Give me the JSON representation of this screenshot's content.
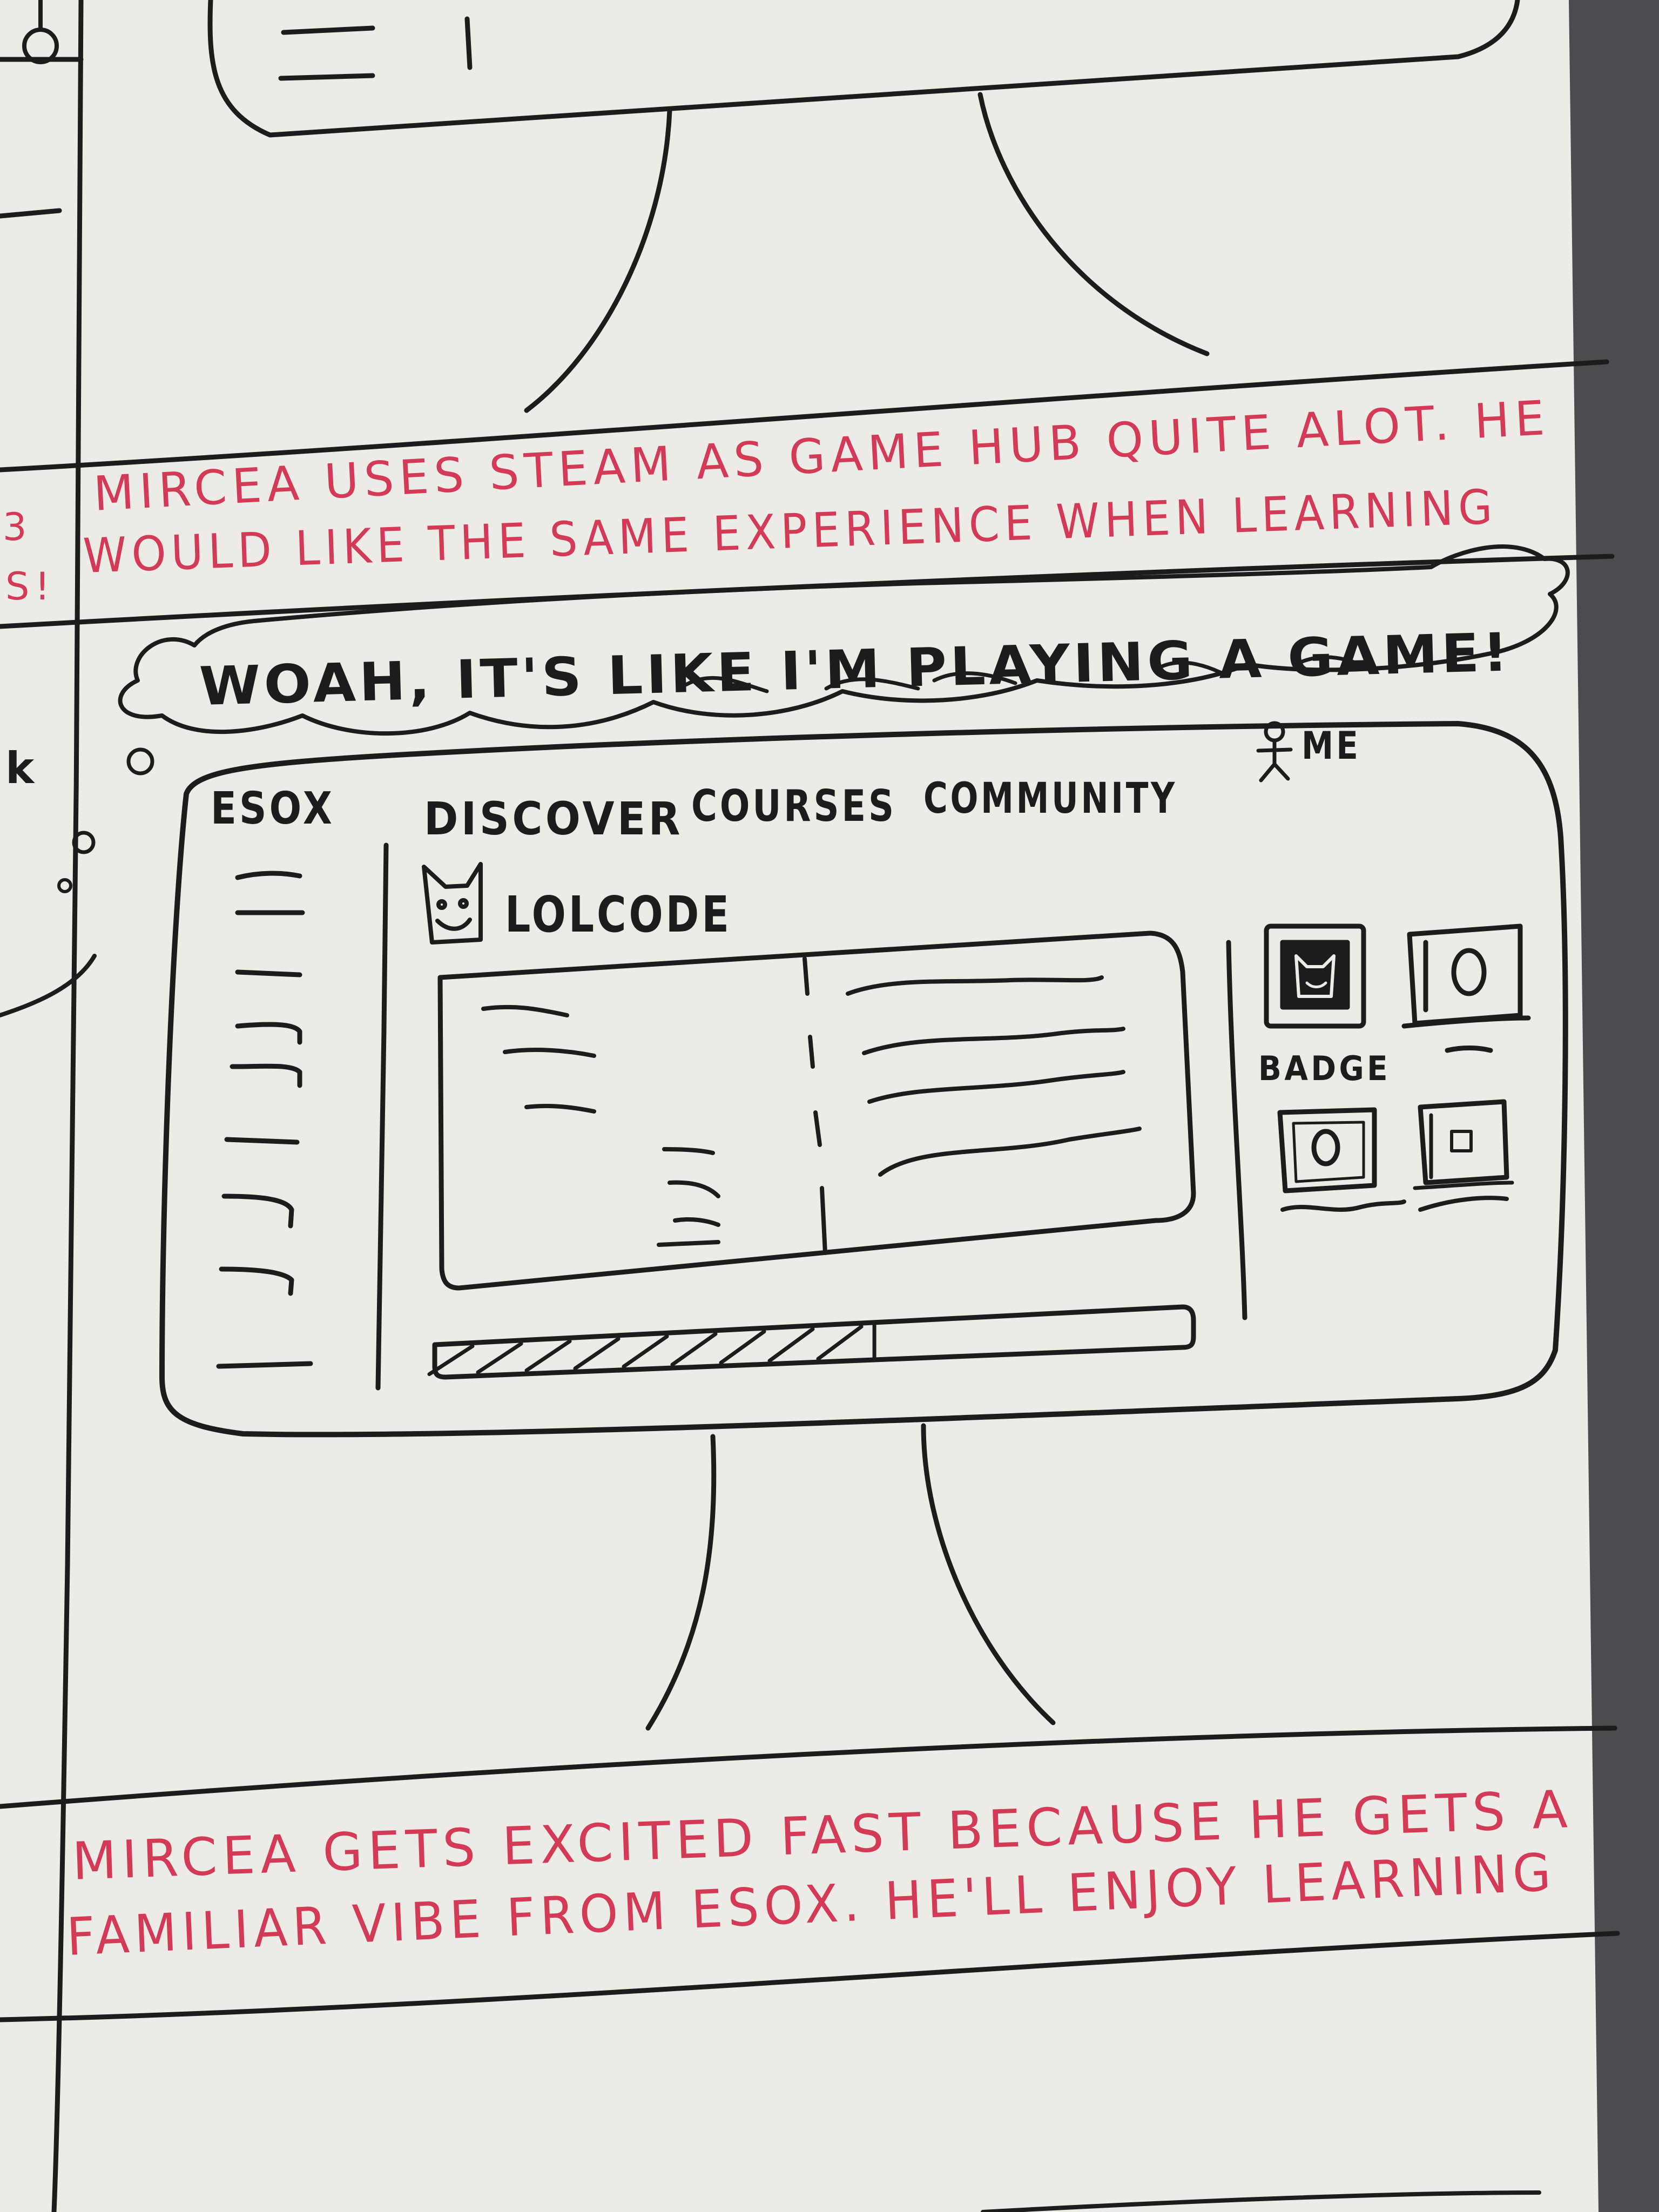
{
  "caption_top": {
    "line1": "MIRCEA USES STEAM AS GAME HUB QUITE ALOT. HE",
    "line2": "WOULD LIKE THE SAME EXPERIENCE WHEN LEARNING"
  },
  "thought_bubble": "WOAH, IT'S LIKE I'M PLAYING A GAME!",
  "screen": {
    "logo": "ESOX",
    "nav": [
      "DISCOVER",
      "COURSES",
      "COMMUNITY"
    ],
    "user_label": "ME",
    "course_title": "LOLCODE",
    "badges_label": "BADGE",
    "progress": 0.58
  },
  "caption_bottom": {
    "line1": "MIRCEA GETS EXCITED FAST BECAUSE HE GETS A",
    "line2": "FAMILIAR VIBE FROM ESOX. HE'LL ENJOY LEARNING"
  },
  "colors": {
    "paper": "#ecebe6",
    "ink": "#1c1c1c",
    "red_ink": "#d23a55",
    "background": "#4a4c50"
  },
  "icons": {
    "course": "cat-face-icon",
    "user": "stick-figure-icon"
  }
}
